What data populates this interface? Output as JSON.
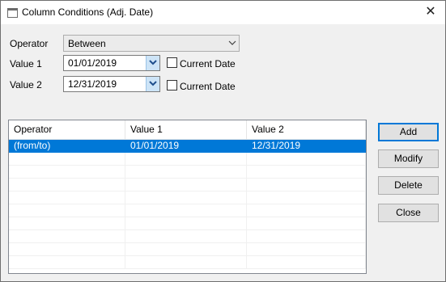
{
  "window": {
    "title": "Column Conditions (Adj. Date)"
  },
  "form": {
    "operator_label": "Operator",
    "operator_value": "Between",
    "value1_label": "Value 1",
    "value1_date": "01/01/2019",
    "value1_current_label": "Current Date",
    "value1_current_checked": false,
    "value2_label": "Value 2",
    "value2_date": "12/31/2019",
    "value2_current_label": "Current Date",
    "value2_current_checked": false
  },
  "table": {
    "headers": [
      "Operator",
      "Value 1",
      "Value 2"
    ],
    "rows": [
      [
        "(from/to)",
        "01/01/2019",
        "12/31/2019"
      ]
    ],
    "selected_row": 0
  },
  "buttons": {
    "add": "Add",
    "modify": "Modify",
    "delete": "Delete",
    "close": "Close"
  },
  "icons": {
    "close": "close-icon",
    "dropdown": "chevron-down-icon",
    "date_picker": "chevron-down-icon"
  },
  "colors": {
    "selection": "#0078d7",
    "date_button": "#cde4f7",
    "window_bg": "#f0f0f0"
  }
}
